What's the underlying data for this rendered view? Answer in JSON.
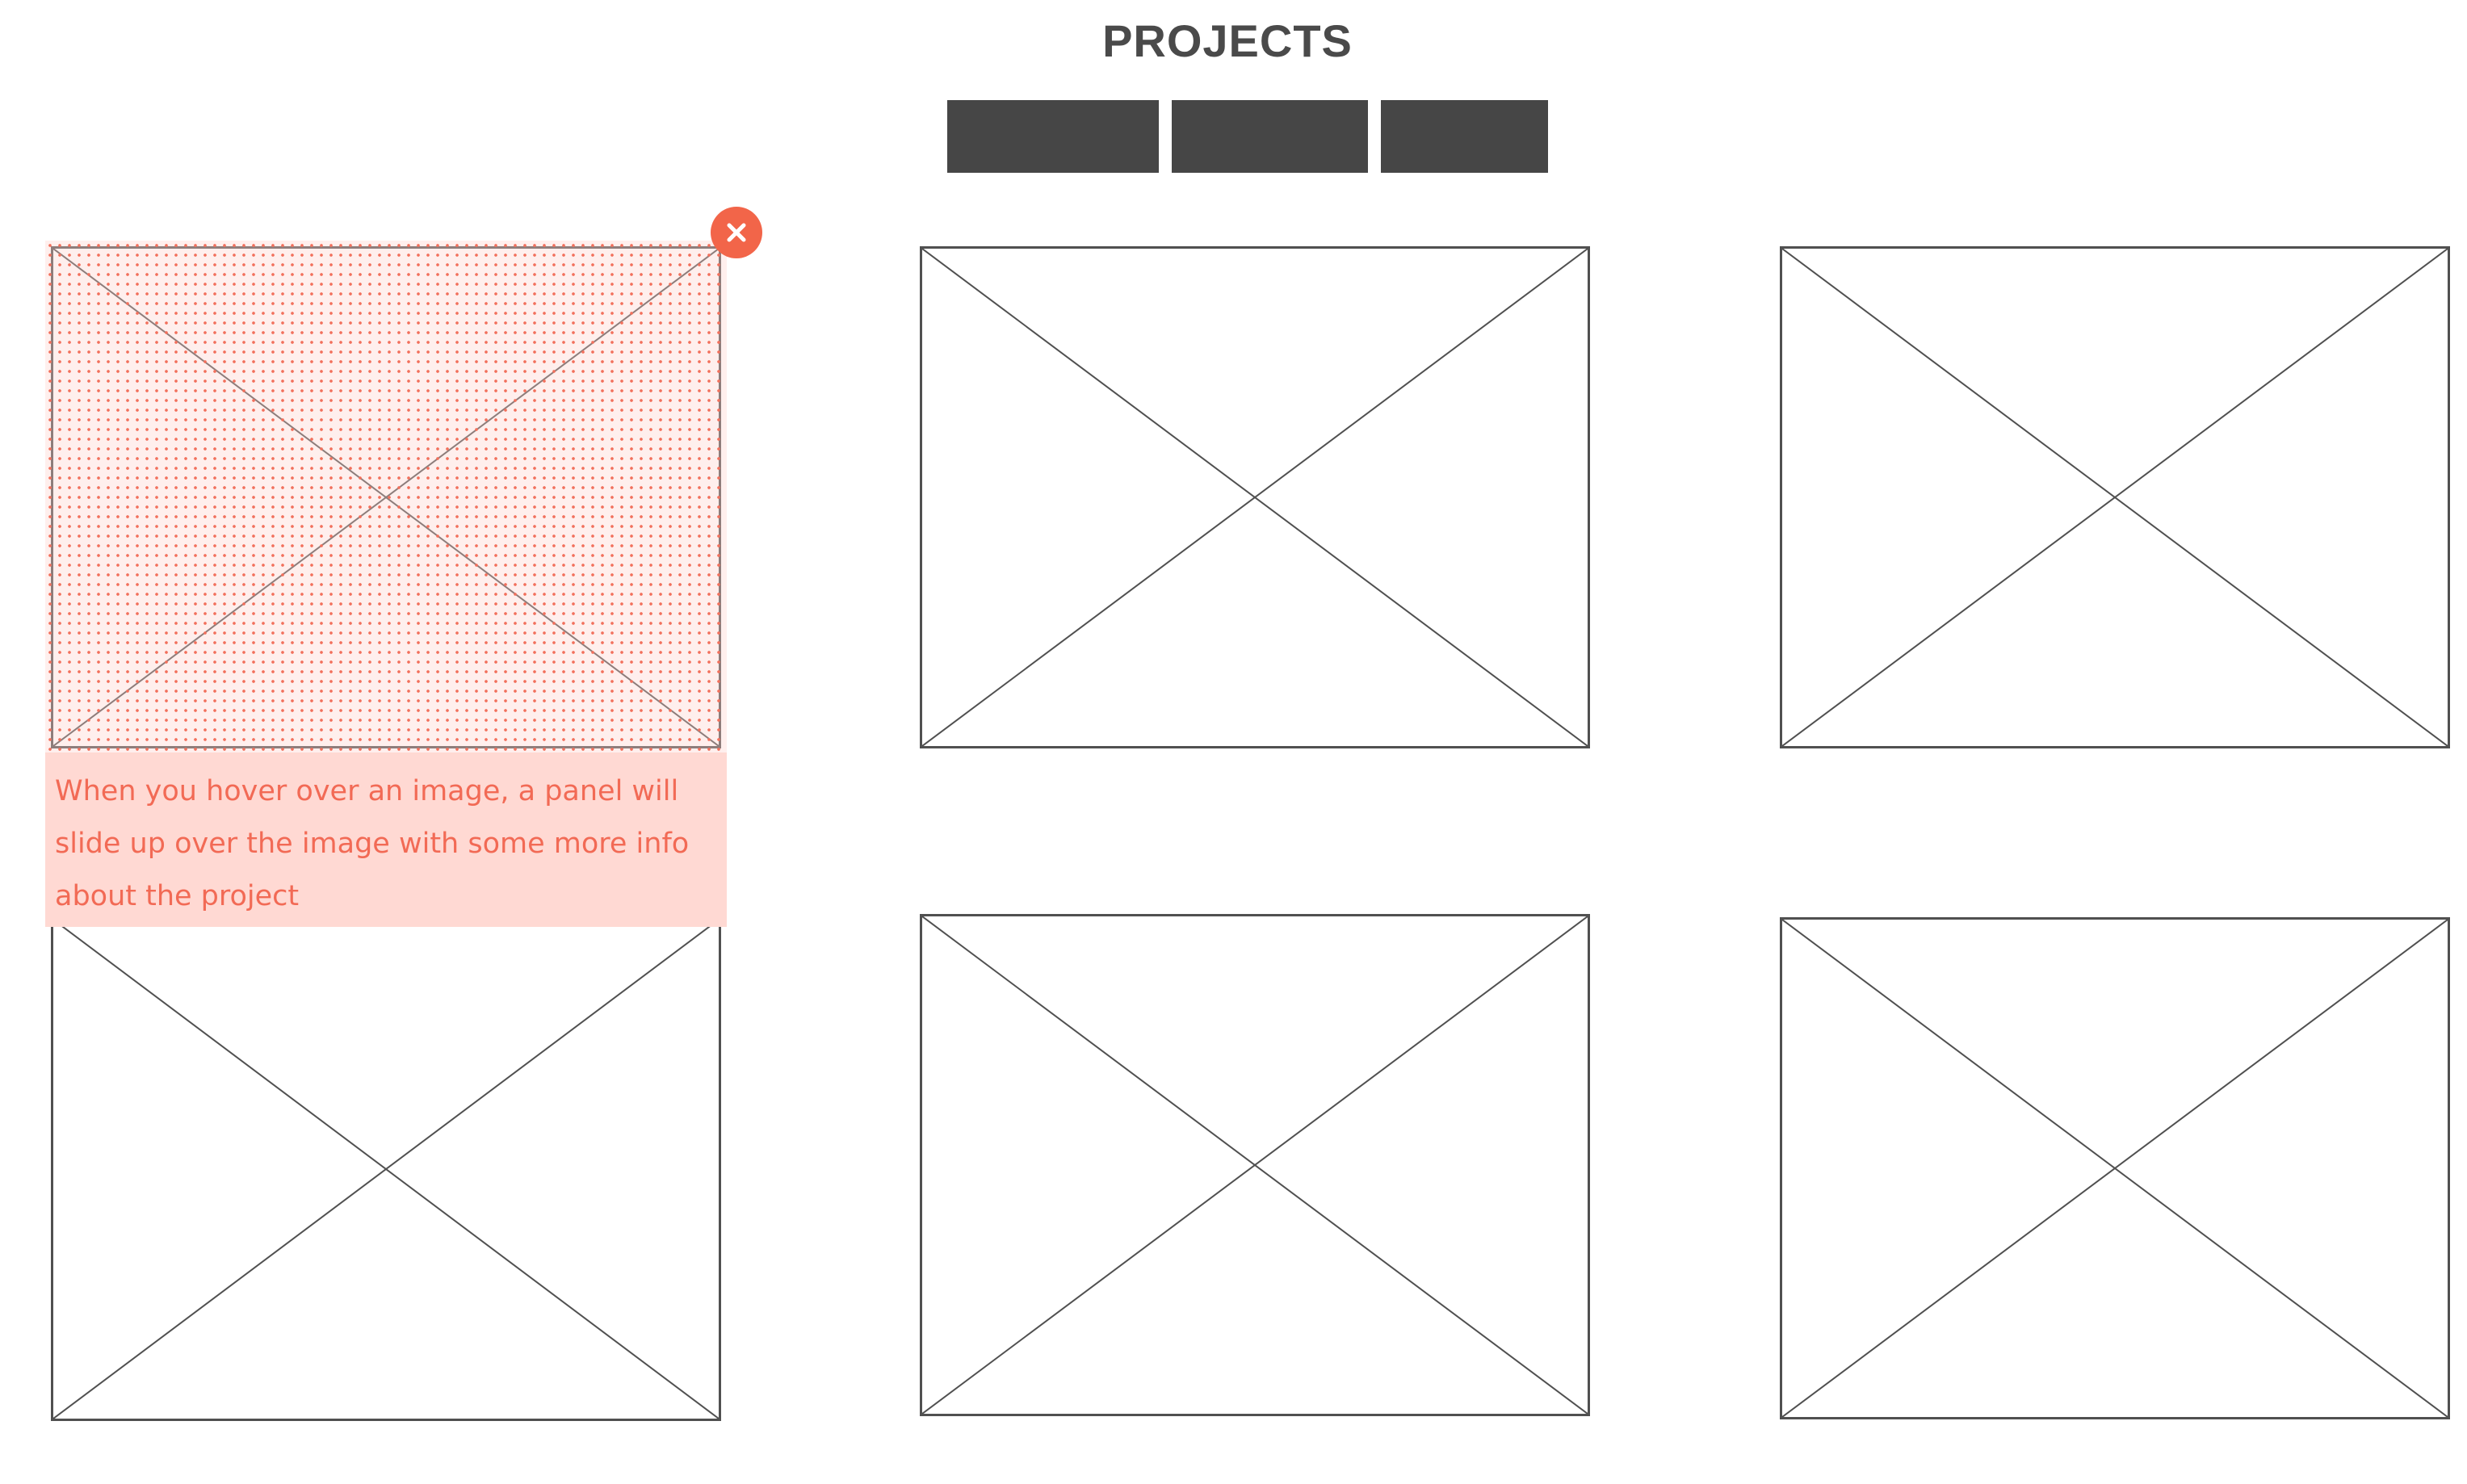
{
  "header": {
    "title": "PROJECTS"
  },
  "filters": {
    "buttons": [
      {
        "label": ""
      },
      {
        "label": ""
      },
      {
        "label": ""
      }
    ]
  },
  "hover_panel": {
    "text": "When you hover over an image, a panel will slide up over the image with some more info about the project"
  },
  "icons": {
    "close": "close-icon",
    "image_placeholder": "image-placeholder-icon"
  },
  "colors": {
    "title_text": "#4a4a4a",
    "filter_button": "#464646",
    "placeholder_border": "#505050",
    "accent": "#f26549",
    "panel_background": "#ffd9d3",
    "panel_text": "#f26a55"
  }
}
